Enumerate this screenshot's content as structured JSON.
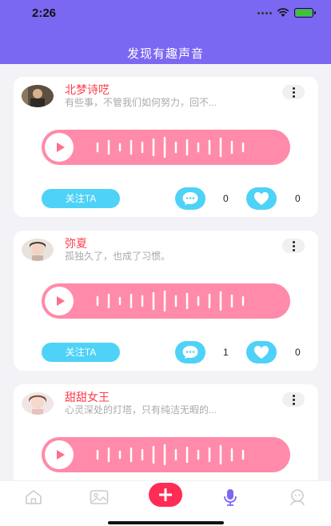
{
  "status_bar": {
    "time": "2:26"
  },
  "header": {
    "title": "发现有趣声音"
  },
  "posts": [
    {
      "name": "北梦诗呓",
      "desc": "有些事，不管我们如何努力，回不...",
      "follow_label": "关注TA",
      "comments": "0",
      "likes": "0"
    },
    {
      "name": "弥夏",
      "desc": "孤独久了，也成了习惯。",
      "follow_label": "关注TA",
      "comments": "1",
      "likes": "0"
    },
    {
      "name": "甜甜女王",
      "desc": "心灵深处的灯塔，只有纯洁无暇的..."
    }
  ],
  "colors": {
    "header": "#7a68f2",
    "name_red": "#ff3d4a",
    "voice_pink": "#ff8aaa",
    "action_blue": "#4ed2f7",
    "add_red": "#ff2c55",
    "tab_active": "#7a68f2"
  },
  "tab_bar": {
    "items": [
      {
        "icon": "home-icon"
      },
      {
        "icon": "image-icon"
      },
      {
        "icon": "add-icon"
      },
      {
        "icon": "microphone-icon",
        "active": true
      },
      {
        "icon": "profile-icon"
      }
    ]
  }
}
